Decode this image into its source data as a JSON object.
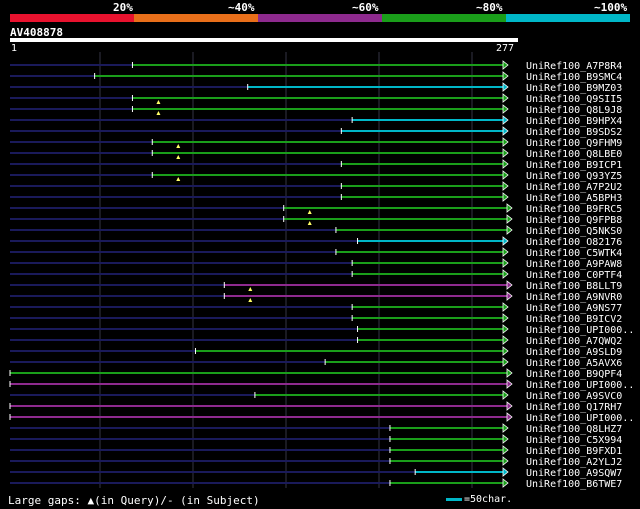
{
  "legend": {
    "labels": [
      "20%",
      "~40%",
      "~60%",
      "~80%",
      "~100%"
    ],
    "colors": [
      "#e8122e",
      "#e86f1a",
      "#8e2a8e",
      "#1a9e1a",
      "#00b7c8"
    ]
  },
  "query": {
    "id": "AV408878",
    "start_label": "1",
    "end_label": "277",
    "length": 277
  },
  "footer": {
    "gaps_text": "Large gaps: ▲(in Query)/- (in Subject)",
    "scale_text": "=50char."
  },
  "hits": [
    {
      "name": "UniRef100_A7P8R4",
      "start": 69,
      "color": "#1a9e1a",
      "gap": false,
      "arrow": false
    },
    {
      "name": "UniRef100_B9SMC4",
      "start": 48,
      "color": "#1a9e1a",
      "gap": false,
      "arrow": false
    },
    {
      "name": "UniRef100_B9MZ03",
      "start": 133,
      "color": "#00b7c8",
      "gap": false,
      "arrow": false
    },
    {
      "name": "UniRef100_Q9SII5",
      "start": 69,
      "color": "#1a9e1a",
      "gap": true,
      "arrow": false
    },
    {
      "name": "UniRef100_Q8L9J8",
      "start": 69,
      "color": "#1a9e1a",
      "gap": true,
      "arrow": false
    },
    {
      "name": "UniRef100_B9HPX4",
      "start": 191,
      "color": "#00b7c8",
      "gap": false,
      "arrow": false
    },
    {
      "name": "UniRef100_B9SDS2",
      "start": 185,
      "color": "#00b7c8",
      "gap": false,
      "arrow": false
    },
    {
      "name": "UniRef100_Q9FHM9",
      "start": 80,
      "color": "#1a9e1a",
      "gap": true,
      "arrow": false
    },
    {
      "name": "UniRef100_Q8LBE0",
      "start": 80,
      "color": "#1a9e1a",
      "gap": true,
      "arrow": false
    },
    {
      "name": "UniRef100_B9ICP1",
      "start": 185,
      "color": "#1a9e1a",
      "gap": false,
      "arrow": false
    },
    {
      "name": "UniRef100_Q93YZ5",
      "start": 80,
      "color": "#1a9e1a",
      "gap": true,
      "arrow": false
    },
    {
      "name": "UniRef100_A7P2U2",
      "start": 185,
      "color": "#1a9e1a",
      "gap": false,
      "arrow": false
    },
    {
      "name": "UniRef100_A5BPH3",
      "start": 185,
      "color": "#1a9e1a",
      "gap": false,
      "arrow": false
    },
    {
      "name": "UniRef100_B9FRC5",
      "start": 153,
      "color": "#1a9e1a",
      "gap": true,
      "arrow": true
    },
    {
      "name": "UniRef100_Q9FPB8",
      "start": 153,
      "color": "#1a9e1a",
      "gap": true,
      "arrow": true
    },
    {
      "name": "UniRef100_Q5NKS0",
      "start": 182,
      "color": "#1a9e1a",
      "gap": false,
      "arrow": true
    },
    {
      "name": "UniRef100_O82176",
      "start": 194,
      "color": "#00b7c8",
      "gap": false,
      "arrow": false
    },
    {
      "name": "UniRef100_C5WTK4",
      "start": 182,
      "color": "#1a9e1a",
      "gap": false,
      "arrow": false
    },
    {
      "name": "UniRef100_A9PAW8",
      "start": 191,
      "color": "#1a9e1a",
      "gap": false,
      "arrow": false
    },
    {
      "name": "UniRef100_C0PTF4",
      "start": 191,
      "color": "#1a9e1a",
      "gap": false,
      "arrow": false
    },
    {
      "name": "UniRef100_B8LLT9",
      "start": 120,
      "color": "#8e2a8e",
      "gap": true,
      "arrow": true
    },
    {
      "name": "UniRef100_A9NVR0",
      "start": 120,
      "color": "#8e2a8e",
      "gap": true,
      "arrow": true
    },
    {
      "name": "UniRef100_A9NS77",
      "start": 191,
      "color": "#1a9e1a",
      "gap": false,
      "arrow": false
    },
    {
      "name": "UniRef100_B9ICV2",
      "start": 191,
      "color": "#1a9e1a",
      "gap": false,
      "arrow": false
    },
    {
      "name": "UniRef100_UPI000..",
      "start": 194,
      "color": "#1a9e1a",
      "gap": false,
      "arrow": false
    },
    {
      "name": "UniRef100_A7QWQ2",
      "start": 194,
      "color": "#1a9e1a",
      "gap": false,
      "arrow": false
    },
    {
      "name": "UniRef100_A9SLD9",
      "start": 104,
      "color": "#1a9e1a",
      "gap": false,
      "arrow": false
    },
    {
      "name": "UniRef100_A5AVX6",
      "start": 176,
      "color": "#1a9e1a",
      "gap": false,
      "arrow": false
    },
    {
      "name": "UniRef100_B9QPF4",
      "start": 1,
      "color": "#1a9e1a",
      "gap": false,
      "arrow": true
    },
    {
      "name": "UniRef100_UPI000..",
      "start": 1,
      "color": "#8e2a8e",
      "gap": false,
      "arrow": true
    },
    {
      "name": "UniRef100_A9SVC0",
      "start": 137,
      "color": "#1a9e1a",
      "gap": false,
      "arrow": false
    },
    {
      "name": "UniRef100_Q17RH7",
      "start": 1,
      "color": "#8e2a8e",
      "gap": false,
      "arrow": true
    },
    {
      "name": "UniRef100_UPI000..",
      "start": 1,
      "color": "#8e2a8e",
      "gap": false,
      "arrow": true
    },
    {
      "name": "UniRef100_Q8LHZ7",
      "start": 212,
      "color": "#1a9e1a",
      "gap": false,
      "arrow": false
    },
    {
      "name": "UniRef100_C5X994",
      "start": 212,
      "color": "#1a9e1a",
      "gap": false,
      "arrow": false
    },
    {
      "name": "UniRef100_B9FXD1",
      "start": 212,
      "color": "#1a9e1a",
      "gap": false,
      "arrow": false
    },
    {
      "name": "UniRef100_A2YLJ2",
      "start": 212,
      "color": "#1a9e1a",
      "gap": false,
      "arrow": false
    },
    {
      "name": "UniRef100_A9SQW7",
      "start": 226,
      "color": "#00b7c8",
      "gap": false,
      "arrow": false
    },
    {
      "name": "UniRef100_B6TWE7",
      "start": 212,
      "color": "#1a9e1a",
      "gap": false,
      "arrow": false
    }
  ]
}
